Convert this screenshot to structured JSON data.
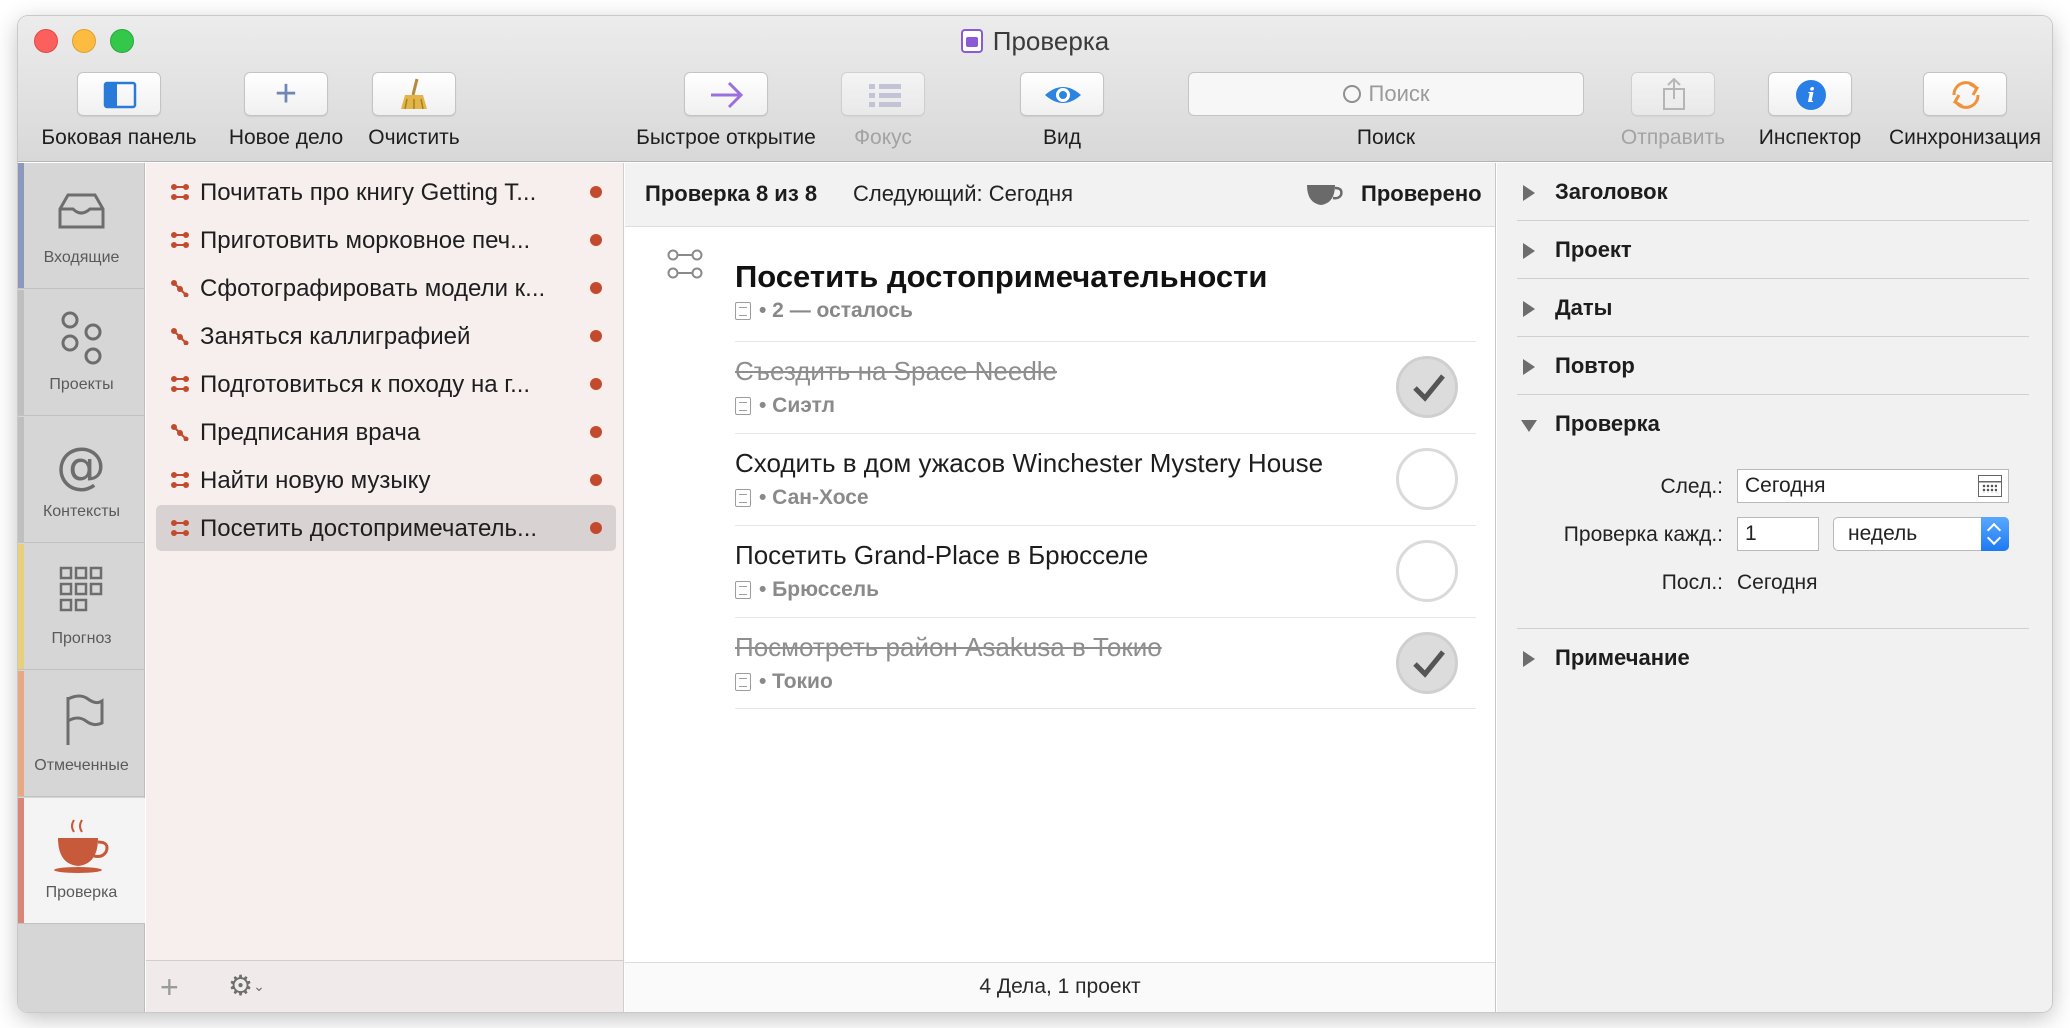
{
  "window": {
    "title": "Проверка"
  },
  "toolbar": {
    "sidebar": "Боковая панель",
    "new_action": "Новое дело",
    "clean_up": "Очистить",
    "quick_open": "Быстрое открытие",
    "focus": "Фокус",
    "view": "Вид",
    "search_placeholder": "Поиск",
    "search_label": "Поиск",
    "share": "Отправить",
    "inspector": "Инспектор",
    "sync": "Синхронизация"
  },
  "rail": {
    "tabs": [
      {
        "label": "Входящие",
        "icon": "inbox-icon",
        "stripe": "#8d98bd"
      },
      {
        "label": "Проекты",
        "icon": "projects-icon",
        "stripe": "#bfbfbf"
      },
      {
        "label": "Контексты",
        "icon": "contexts-icon",
        "stripe": "#bfbfbf"
      },
      {
        "label": "Прогноз",
        "icon": "forecast-icon",
        "stripe": "#e8cf7a"
      },
      {
        "label": "Отмеченные",
        "icon": "flag-icon",
        "stripe": "#e8a884"
      },
      {
        "label": "Проверка",
        "icon": "review-cup-icon",
        "stripe": "#d98578"
      }
    ]
  },
  "list": {
    "items": [
      {
        "label": "Почитать про книгу Getting T..."
      },
      {
        "label": "Приготовить морковное печ..."
      },
      {
        "label": "Сфотографировать модели к..."
      },
      {
        "label": "Заняться каллиграфией"
      },
      {
        "label": "Подготовиться к походу на г..."
      },
      {
        "label": "Предписания врача"
      },
      {
        "label": "Найти новую музыку"
      },
      {
        "label": "Посетить достопримечатель..."
      }
    ],
    "accent_color": "#c44a2e"
  },
  "main": {
    "review_count": "Проверка 8 из 8",
    "next": "Следующий: Сегодня",
    "reviewed": "Проверено",
    "project_title": "Посетить достопримечательности",
    "project_sub": "• 2 — осталось",
    "tasks": [
      {
        "title": "Съездить на Space Needle",
        "context": "• Сиэтл",
        "done": true
      },
      {
        "title": "Сходить в дом ужасов Winchester Mystery House",
        "context": "• Сан-Хосе",
        "done": false
      },
      {
        "title": "Посетить Grand-Place в Брюсселе",
        "context": "• Брюссель",
        "done": false
      },
      {
        "title": "Посмотреть район Asakusa в Токио",
        "context": "• Токио",
        "done": true
      }
    ],
    "footer": "4 Дела, 1 проект"
  },
  "inspector": {
    "sections": {
      "title": "Заголовок",
      "project": "Проект",
      "dates": "Даты",
      "repeat": "Повтор",
      "review": "Проверка",
      "note": "Примечание"
    },
    "review_fields": {
      "next_label": "След.:",
      "next_value": "Сегодня",
      "every_label": "Проверка кажд.:",
      "every_value": "1",
      "unit_value": "недель",
      "last_label": "Посл.:",
      "last_value": "Сегодня"
    }
  }
}
